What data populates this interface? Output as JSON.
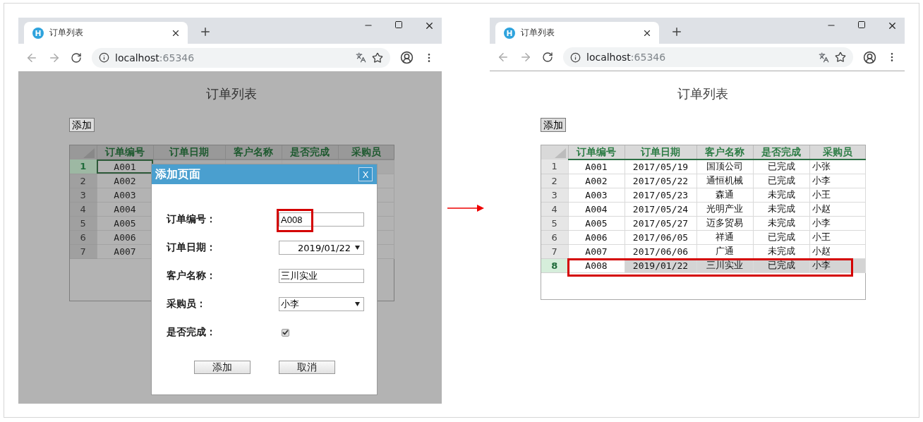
{
  "left_window": {
    "tab_title": "订单列表",
    "url_host": "localhost",
    "url_port": ":65346",
    "page_title": "订单列表",
    "add_button": "添加",
    "table": {
      "columns": [
        "订单编号",
        "订单日期",
        "客户名称",
        "是否完成",
        "采购员"
      ],
      "rows": [
        {
          "number": "1",
          "cells": [
            "A001"
          ],
          "selected": true
        },
        {
          "number": "2",
          "cells": [
            "A002"
          ],
          "selected": false
        },
        {
          "number": "3",
          "cells": [
            "A003"
          ],
          "selected": false
        },
        {
          "number": "4",
          "cells": [
            "A004"
          ],
          "selected": false
        },
        {
          "number": "5",
          "cells": [
            "A005"
          ],
          "selected": false
        },
        {
          "number": "6",
          "cells": [
            "A006"
          ],
          "selected": false
        },
        {
          "number": "7",
          "cells": [
            "A007"
          ],
          "selected": false
        }
      ]
    },
    "dialog": {
      "title": "添加页面",
      "close": "X",
      "fields": [
        {
          "kind": "text",
          "label": "订单编号：",
          "value": "A008",
          "highlighted": true
        },
        {
          "kind": "date",
          "label": "订单日期：",
          "value": "2019/01/22"
        },
        {
          "kind": "text",
          "label": "客户名称：",
          "value": "三川实业"
        },
        {
          "kind": "select",
          "label": "采购员：",
          "value": "小李"
        },
        {
          "kind": "checkbox",
          "label": "是否完成：",
          "checked": true
        }
      ],
      "buttons": [
        "添加",
        "取消"
      ]
    }
  },
  "right_window": {
    "tab_title": "订单列表",
    "url_host": "localhost",
    "url_port": ":65346",
    "page_title": "订单列表",
    "add_button": "添加",
    "table": {
      "columns": [
        "订单编号",
        "订单日期",
        "客户名称",
        "是否完成",
        "采购员"
      ],
      "rows": [
        {
          "number": "1",
          "cells": [
            "A001",
            "2017/05/19",
            "国顶公司",
            "已完成",
            "小张"
          ],
          "selected": false
        },
        {
          "number": "2",
          "cells": [
            "A002",
            "2017/05/22",
            "通恒机械",
            "已完成",
            "小李"
          ],
          "selected": false
        },
        {
          "number": "3",
          "cells": [
            "A003",
            "2017/05/23",
            "森通",
            "未完成",
            "小王"
          ],
          "selected": false
        },
        {
          "number": "4",
          "cells": [
            "A004",
            "2017/05/24",
            "光明产业",
            "未完成",
            "小赵"
          ],
          "selected": false
        },
        {
          "number": "5",
          "cells": [
            "A005",
            "2017/05/27",
            "迈多贸易",
            "未完成",
            "小李"
          ],
          "selected": false
        },
        {
          "number": "6",
          "cells": [
            "A006",
            "2017/06/05",
            "祥通",
            "已完成",
            "小王"
          ],
          "selected": false
        },
        {
          "number": "7",
          "cells": [
            "A007",
            "2017/06/06",
            "广通",
            "未完成",
            "小赵"
          ],
          "selected": false
        },
        {
          "number": "8",
          "cells": [
            "A008",
            "2019/01/22",
            "三川实业",
            "已完成",
            "小李"
          ],
          "selected": true,
          "highlighted": true
        }
      ]
    }
  }
}
